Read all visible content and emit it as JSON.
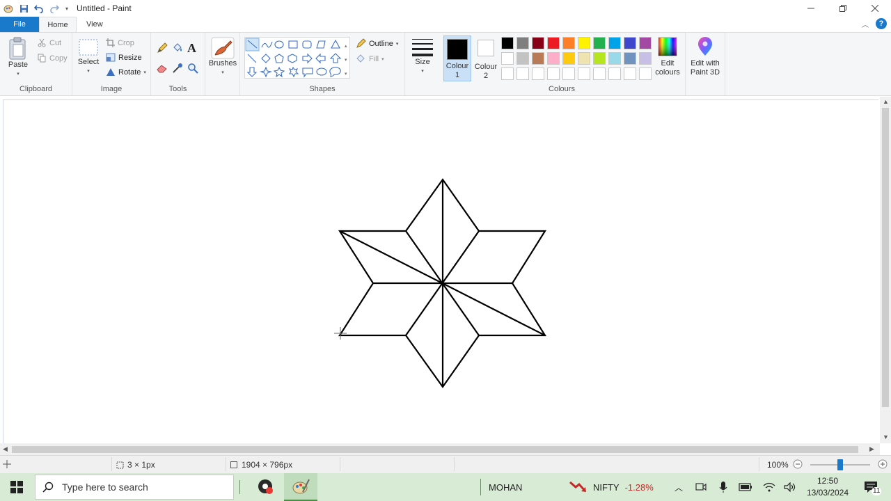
{
  "window": {
    "title": "Untitled - Paint",
    "quick_access": [
      "save-icon",
      "undo-icon",
      "redo-icon",
      "customize-icon"
    ],
    "controls": [
      "minimize-icon",
      "restore-icon",
      "close-icon"
    ]
  },
  "tabs": [
    {
      "label": "File",
      "active": false
    },
    {
      "label": "Home",
      "active": true
    },
    {
      "label": "View",
      "active": false
    }
  ],
  "ribbon": {
    "clipboard": {
      "label": "Clipboard",
      "paste": "Paste",
      "cut": "Cut",
      "copy": "Copy"
    },
    "image": {
      "label": "Image",
      "select": "Select",
      "crop": "Crop",
      "resize": "Resize",
      "rotate": "Rotate"
    },
    "tools": {
      "label": "Tools"
    },
    "brushes": {
      "label": "Brushes"
    },
    "shapes": {
      "label": "Shapes",
      "outline": "Outline",
      "fill": "Fill"
    },
    "size": {
      "label": "Size"
    },
    "colours": {
      "label": "Colours",
      "colour1_a": "Colour",
      "colour1_b": "1",
      "colour2_a": "Colour",
      "colour2_b": "2",
      "edit_a": "Edit",
      "edit_b": "colours",
      "paint3d_a": "Edit with",
      "paint3d_b": "Paint 3D",
      "colour1_value": "#000000",
      "colour2_value": "#ffffff",
      "palette_row1": [
        "#000000",
        "#7f7f7f",
        "#880015",
        "#ed1c24",
        "#ff7f27",
        "#fff200",
        "#22b14c",
        "#00a2e8",
        "#3f48cc",
        "#a349a4"
      ],
      "palette_row2": [
        "#ffffff",
        "#c3c3c3",
        "#b97a57",
        "#ffaec9",
        "#ffc90e",
        "#efe4b0",
        "#b5e61d",
        "#99d9ea",
        "#7092be",
        "#c8bfe7"
      ],
      "palette_row3": [
        "#ffffff",
        "#ffffff",
        "#ffffff",
        "#ffffff",
        "#ffffff",
        "#ffffff",
        "#ffffff",
        "#ffffff",
        "#ffffff",
        "#ffffff"
      ]
    }
  },
  "status": {
    "selection_size": "3 × 1px",
    "image_size": "1904 × 796px",
    "zoom": "100%",
    "zoom_fraction": 0.5
  },
  "taskbar": {
    "search_placeholder": "Type here to search",
    "user": "MOHAN",
    "stock_name": "NIFTY",
    "stock_change": "-1.28%",
    "time": "12:50",
    "date": "13/03/2024",
    "notification_count": "11"
  }
}
